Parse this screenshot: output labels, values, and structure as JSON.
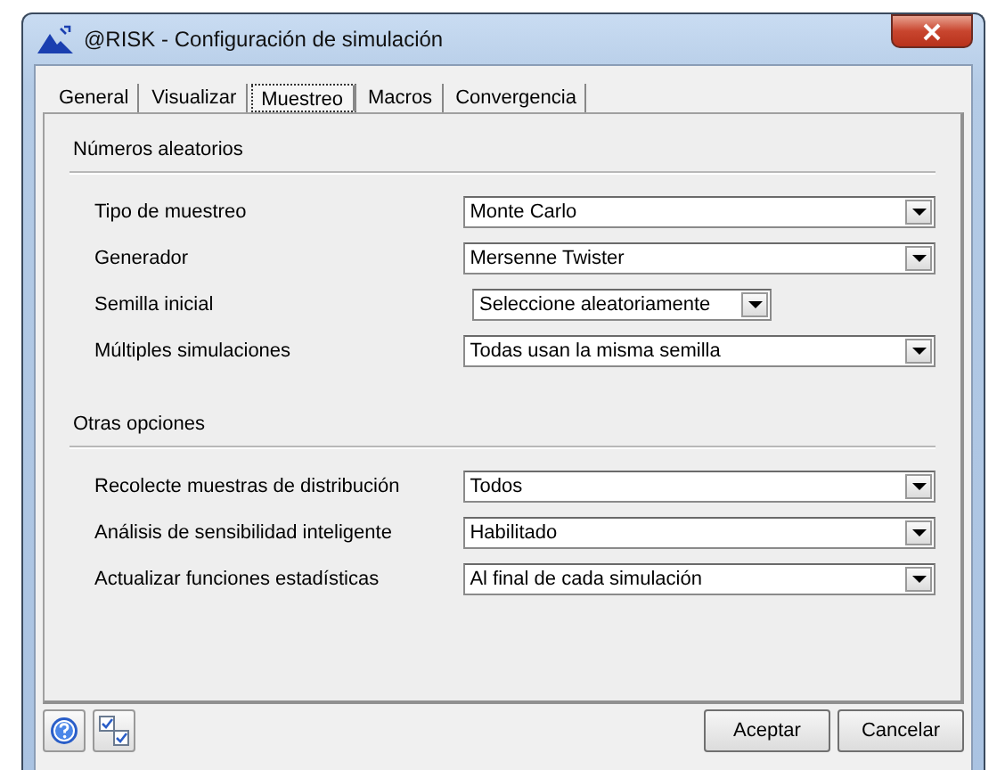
{
  "window": {
    "title": "@RISK - Configuración de simulación"
  },
  "tabs": [
    {
      "label": "General",
      "selected": false
    },
    {
      "label": "Visualizar",
      "selected": false
    },
    {
      "label": "Muestreo",
      "selected": true
    },
    {
      "label": "Macros",
      "selected": false
    },
    {
      "label": "Convergencia",
      "selected": false
    }
  ],
  "sections": [
    {
      "title": "Números aleatorios",
      "fields": [
        {
          "label": "Tipo de muestreo",
          "value": "Monte Carlo",
          "kind": "wide"
        },
        {
          "label": "Generador",
          "value": "Mersenne Twister",
          "kind": "wide"
        },
        {
          "label": "Semilla inicial",
          "value": "Seleccione aleatoriamente",
          "kind": "narrow"
        },
        {
          "label": "Múltiples simulaciones",
          "value": "Todas usan la misma semilla",
          "kind": "wide"
        }
      ]
    },
    {
      "title": "Otras opciones",
      "fields": [
        {
          "label": "Recolecte muestras de distribución",
          "value": "Todos",
          "kind": "wide"
        },
        {
          "label": "Análisis de sensibilidad inteligente",
          "value": "Habilitado",
          "kind": "wide"
        },
        {
          "label": "Actualizar funciones estadísticas",
          "value": "Al final de cada simulación",
          "kind": "wide"
        }
      ]
    }
  ],
  "footer_buttons": [
    "Aceptar",
    "Cancelar"
  ]
}
